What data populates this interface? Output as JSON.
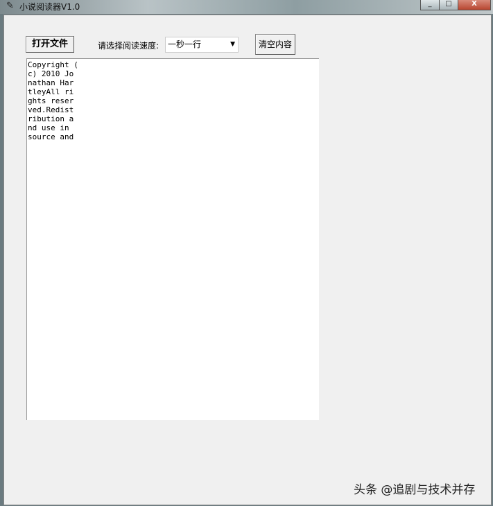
{
  "window": {
    "title": "小说阅读器V1.0",
    "minimize": "_",
    "maximize": "□",
    "close": "X"
  },
  "toolbar": {
    "open_label": "打开文件",
    "speed_label": "请选择阅读速度:",
    "speed_value": "一秒一行",
    "clear_label": "清空内容"
  },
  "text_lines": [
    "Copyright (",
    "c) 2010 Jo",
    "nathan Har",
    "tleyAll ri",
    "ghts reser",
    "ved.Redist",
    "ribution a",
    "nd use in",
    "source and"
  ],
  "watermark": "头条 @追剧与技术并存"
}
